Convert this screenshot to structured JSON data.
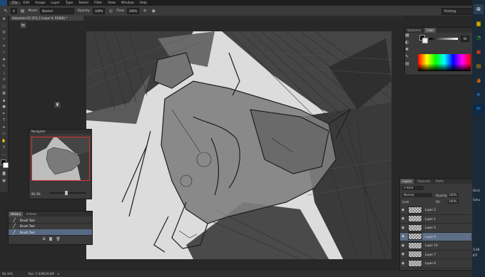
{
  "menu": [
    "File",
    "Edit",
    "Image",
    "Layer",
    "Type",
    "Select",
    "Filter",
    "View",
    "Window",
    "Help"
  ],
  "options": {
    "mode_label": "Mode:",
    "mode_value": "Normal",
    "opacity_label": "Opacity:",
    "opacity_value": "100%",
    "flow_label": "Flow:",
    "flow_value": "100%",
    "brush_size": "4"
  },
  "workspace": "Painting",
  "document_tab": "Sebastian-01-2F6_3 (Layer 9, RGB/8) *",
  "navigator": {
    "title": "Navigator",
    "zoom": "90.3%"
  },
  "history": {
    "tabs": [
      "History",
      "Actions"
    ],
    "items": [
      "Brush Tool",
      "Brush Tool",
      "Brush Tool"
    ]
  },
  "color_panel": {
    "tabs": [
      "Swatches",
      "Color"
    ],
    "value": "93"
  },
  "layers": {
    "tabs": [
      "Layers",
      "Channels",
      "Paths"
    ],
    "kind_label": "Kind",
    "blend_mode": "Normal",
    "opacity_label": "Opacity:",
    "opacity_value": "100%",
    "lock_label": "Lock:",
    "fill_label": "Fill:",
    "fill_value": "100%",
    "rows": [
      "Layer 2",
      "Layer 1",
      "Layer 5",
      "Layer 9",
      "Layer 10",
      "Layer 7",
      "Layer 6",
      "Layer 4"
    ],
    "selected_index": 3
  },
  "status": {
    "zoom": "90.34%",
    "doc": "Doc: 5.63M/29.8M"
  },
  "taskbar": {
    "label1": "Deck",
    "label2": "Sahu",
    "time": "3:38",
    "date": "6/7"
  },
  "colors": {
    "accent": "#5d6e86",
    "canvas_bg": "#dedede",
    "ui_bg": "#282828",
    "panel": "#3a3a3a"
  }
}
